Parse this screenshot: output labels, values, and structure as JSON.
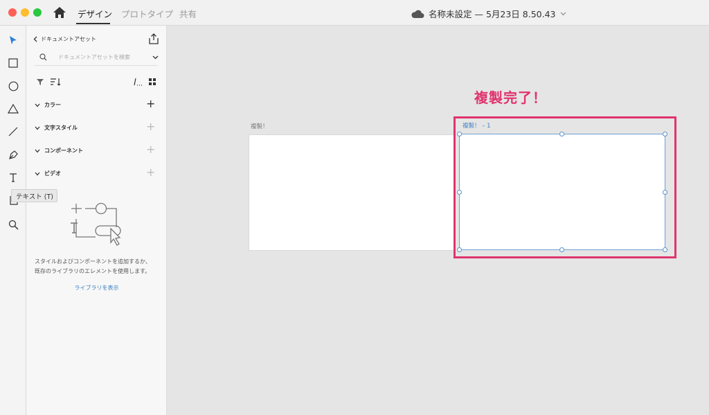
{
  "titlebar": {
    "tabs": [
      "デザイン",
      "プロトタイプ",
      "共有"
    ],
    "active_tab": "デザイン",
    "doc_title": "名称未設定 — 5月23日 8.50.43"
  },
  "toolbar": {
    "tools": [
      "select-tool",
      "rectangle-tool",
      "ellipse-tool",
      "triangle-tool",
      "line-tool",
      "pen-tool",
      "text-tool",
      "artboard-tool",
      "zoom-tool"
    ],
    "tooltip": "テキスト (T)"
  },
  "panel": {
    "header": "ドキュメントアセット",
    "search_placeholder": "ドキュメントアセットを検索",
    "sections": [
      {
        "label": "カラー"
      },
      {
        "label": "文字スタイル"
      },
      {
        "label": "コンポーネント"
      },
      {
        "label": "ビデオ"
      }
    ],
    "empty_line1": "スタイルおよびコンポーネントを追加するか、",
    "empty_line2": "既存のライブラリのエレメントを使用します。",
    "library_link": "ライブラリを表示"
  },
  "canvas": {
    "artboard1_label": "複製！",
    "artboard2_label": "複製！ – 1",
    "annotation": "複製完了！",
    "highlight_color": "#e0336e",
    "selection_color": "#5b8fc9"
  }
}
